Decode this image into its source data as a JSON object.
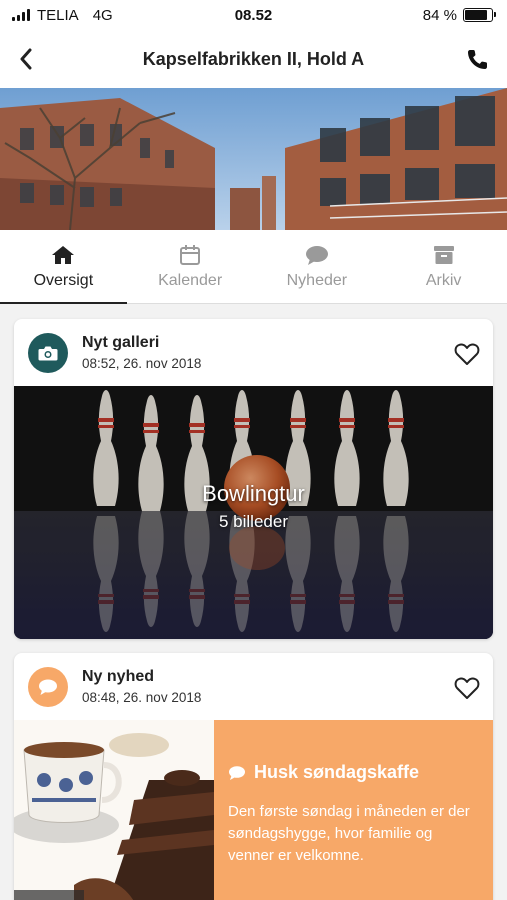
{
  "status_bar": {
    "carrier": "TELIA",
    "network": "4G",
    "time": "08.52",
    "battery_text": "84 %",
    "battery_level": 0.84
  },
  "header": {
    "title": "Kapselfabrikken II, Hold A",
    "back_icon": "chevron-left-icon",
    "call_icon": "phone-icon"
  },
  "tabs": [
    {
      "label": "Oversigt",
      "icon": "home-icon",
      "active": true
    },
    {
      "label": "Kalender",
      "icon": "calendar-icon",
      "active": false
    },
    {
      "label": "Nyheder",
      "icon": "chat-bubble-icon",
      "active": false
    },
    {
      "label": "Arkiv",
      "icon": "archive-icon",
      "active": false
    }
  ],
  "feed": [
    {
      "type": "gallery",
      "title": "Nyt galleri",
      "timestamp": "08:52, 26. nov 2018",
      "icon": "camera-icon",
      "icon_bg": "#1f5a5c",
      "gallery_name": "Bowlingtur",
      "image_count": "5 billeder"
    },
    {
      "type": "news",
      "title": "Ny nyhed",
      "timestamp": "08:48, 26. nov 2018",
      "icon": "chat-bubble-icon",
      "icon_bg": "#f7a868",
      "headline": "Husk søndagskaffe",
      "excerpt": "Den første søndag i måneden er der søndagshygge, hvor familie og venner er velkomne."
    }
  ],
  "colors": {
    "accent_teal": "#1f5a5c",
    "accent_orange": "#f7a868",
    "active_tab": "#222222",
    "inactive_tab": "#9a9a9a"
  }
}
